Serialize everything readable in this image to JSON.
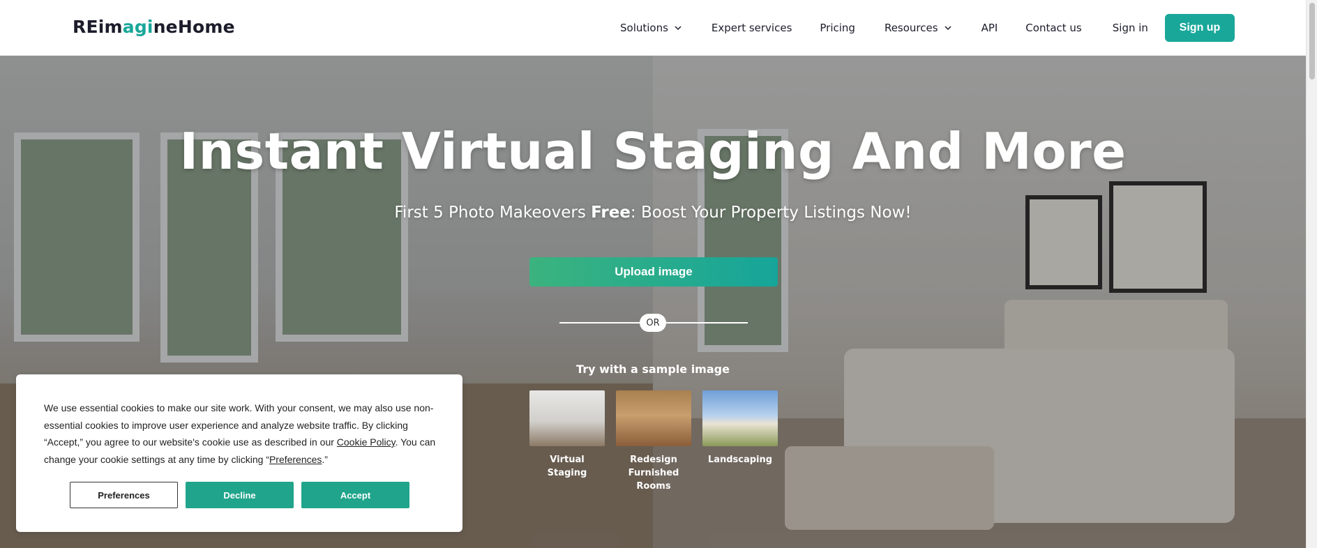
{
  "navbar": {
    "logo_prefix": "REim",
    "logo_accent": "agi",
    "logo_suffix": "neHome",
    "items": [
      {
        "label": "Solutions",
        "has_dropdown": true
      },
      {
        "label": "Expert services",
        "has_dropdown": false
      },
      {
        "label": "Pricing",
        "has_dropdown": false
      },
      {
        "label": "Resources",
        "has_dropdown": true
      },
      {
        "label": "API",
        "has_dropdown": false
      },
      {
        "label": "Contact us",
        "has_dropdown": false
      },
      {
        "label": "Sign in",
        "has_dropdown": false
      }
    ],
    "signup_label": "Sign up"
  },
  "hero": {
    "title": "Instant Virtual Staging And More",
    "subtitle_prefix": "First 5 Photo Makeovers ",
    "subtitle_bold": "Free",
    "subtitle_suffix": ": Boost Your Property Listings Now!",
    "upload_label": "Upload image",
    "or_label": "OR",
    "try_label": "Try with a sample image",
    "samples": [
      {
        "label": "Virtual Staging"
      },
      {
        "label": "Redesign Furnished Rooms"
      },
      {
        "label": "Landscaping"
      }
    ]
  },
  "cookie": {
    "text_1": "We use essential cookies to make our site work. With your consent, we may also use non-essential cookies to improve user experience and analyze website traffic. By clicking “Accept,” you agree to our website's cookie use as described in our ",
    "policy_link": "Cookie Policy",
    "text_2": ". You can change your cookie settings at any time by clicking “",
    "preferences_link": "Preferences",
    "text_3": ".”",
    "preferences_button": "Preferences",
    "decline_button": "Decline",
    "accept_button": "Accept"
  },
  "colors": {
    "brand": "#19a79a",
    "cookie_button": "#20a48b"
  }
}
